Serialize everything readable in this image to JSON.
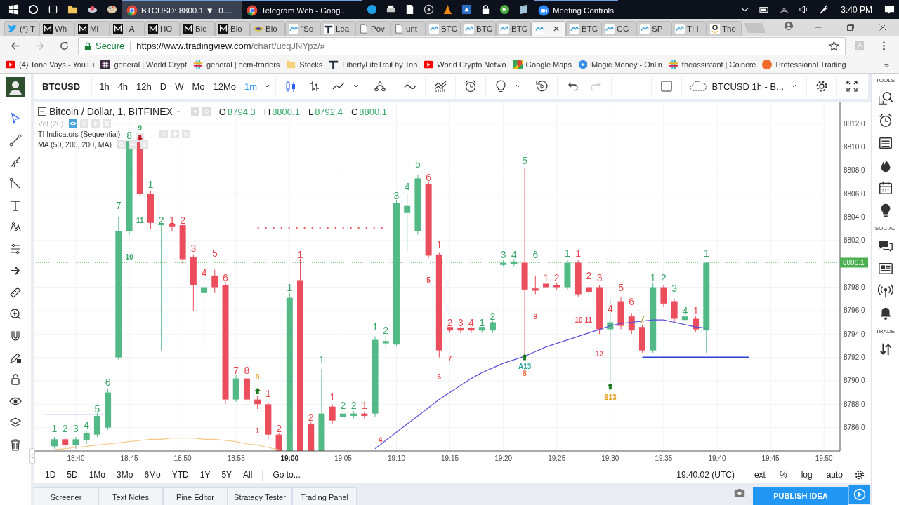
{
  "taskbar": {
    "apps": [
      {
        "title": "BTCUSD: 8800.1 ▼−0....",
        "kind": "browser",
        "selected": true
      },
      {
        "title": "Telegram Web - Goog...",
        "kind": "browser",
        "selected": false
      },
      {
        "title": "Meeting Controls",
        "kind": "meeting",
        "selected": false
      }
    ],
    "clock": "3:40 PM"
  },
  "browser": {
    "tabs": [
      {
        "label": "(*) T",
        "kind": "bird",
        "selected": false
      },
      {
        "label": "Wh",
        "kind": "m",
        "selected": false
      },
      {
        "label": "Mi",
        "kind": "m",
        "selected": false
      },
      {
        "label": "I A",
        "kind": "m",
        "selected": false
      },
      {
        "label": "HO",
        "kind": "m",
        "selected": false
      },
      {
        "label": "Blo",
        "kind": "m",
        "selected": false
      },
      {
        "label": "Blo",
        "kind": "m",
        "selected": false
      },
      {
        "label": "Blo",
        "kind": "wj",
        "selected": false
      },
      {
        "label": "\"Sc",
        "kind": "tv",
        "selected": false
      },
      {
        "label": "Lea",
        "kind": "t",
        "selected": false
      },
      {
        "label": "Pov",
        "kind": "doc",
        "selected": false
      },
      {
        "label": "unt",
        "kind": "doc",
        "selected": false
      },
      {
        "label": "BTC",
        "kind": "tv",
        "selected": false
      },
      {
        "label": "BTC",
        "kind": "tv",
        "selected": false
      },
      {
        "label": "BTC",
        "kind": "tv",
        "selected": false
      },
      {
        "kind": "tv",
        "selected": true
      },
      {
        "label": "BTC",
        "kind": "tv",
        "selected": false
      },
      {
        "label": "GC",
        "kind": "tv",
        "selected": false
      },
      {
        "label": "SP",
        "kind": "tv",
        "selected": false
      },
      {
        "label": "TI I",
        "kind": "tv",
        "selected": false
      },
      {
        "label": "The",
        "kind": "a",
        "selected": false
      }
    ],
    "secure": "Secure",
    "url_host": "https://www.tradingview.com",
    "url_path": "/chart/ucqJNYpz/#",
    "bookmarks": [
      {
        "label": "(4) Tone Vays - YouTu",
        "kind": "play"
      },
      {
        "label": "general | World Crypt",
        "kind": "hash"
      },
      {
        "label": "general | ecm-traders",
        "kind": "slack"
      },
      {
        "label": "Stocks",
        "kind": "folder"
      },
      {
        "label": "LibertyLifeTrail by Ton",
        "kind": "t"
      },
      {
        "label": "World Crypto Netwo",
        "kind": "play"
      },
      {
        "label": "Google Maps",
        "kind": "pin"
      },
      {
        "label": "Magic Money - Onlin",
        "kind": "hex"
      },
      {
        "label": "theassistant | Coincre",
        "kind": "slack"
      },
      {
        "label": "Professional Trading",
        "kind": "circle"
      }
    ],
    "more": "»"
  },
  "chart_toolbar": {
    "symbol": "BTCUSD",
    "intervals": [
      {
        "label": "1h",
        "selected": false
      },
      {
        "label": "4h",
        "selected": false
      },
      {
        "label": "12h",
        "selected": false
      },
      {
        "label": "D",
        "selected": false
      },
      {
        "label": "W",
        "selected": false
      },
      {
        "label": "Mo",
        "selected": false
      },
      {
        "label": "12Mo",
        "selected": false
      },
      {
        "label": "1m",
        "selected": true
      }
    ],
    "layout": "BTCUSD 1h - B..."
  },
  "legend": {
    "title": "Bitcoin / Dollar, 1, BITFINEX",
    "ohlc": [
      {
        "key": "O",
        "value": "8794.3"
      },
      {
        "key": "H",
        "value": "8800.1"
      },
      {
        "key": "L",
        "value": "8792.4"
      },
      {
        "key": "C",
        "value": "8800.1"
      }
    ],
    "indicators": [
      {
        "name": "Vol (20)",
        "hidden": true
      },
      {
        "name": "TI Indicators (Sequential)",
        "hidden": false
      },
      {
        "name": "MA (50, 200, 200, MA)",
        "hidden": false
      }
    ]
  },
  "chart": {
    "price_labels": [
      "8812.0",
      "8810.0",
      "8808.0",
      "8806.0",
      "8804.0",
      "8802.0",
      "8798.0",
      "8796.0",
      "8794.0",
      "8792.0",
      "8790.0",
      "8788.0",
      "8786.0"
    ],
    "last_price": "8800.1",
    "time_labels": [
      {
        "label": "18:40",
        "bold": false
      },
      {
        "label": "18:45",
        "bold": false
      },
      {
        "label": "18:50",
        "bold": false
      },
      {
        "label": "18:55",
        "bold": false
      },
      {
        "label": "19:00",
        "bold": true
      },
      {
        "label": "19:05",
        "bold": false
      },
      {
        "label": "19:10",
        "bold": false
      },
      {
        "label": "19:15",
        "bold": false
      },
      {
        "label": "19:20",
        "bold": false
      },
      {
        "label": "19:25",
        "bold": false
      },
      {
        "label": "19:30",
        "bold": false
      },
      {
        "label": "19:35",
        "bold": false
      },
      {
        "label": "19:40",
        "bold": false
      },
      {
        "label": "19:45",
        "bold": false
      },
      {
        "label": "19:50",
        "bold": false
      }
    ],
    "counts": [
      {
        "text": "1",
        "color": "#3aa86b"
      },
      {
        "text": "2",
        "color": "#3aa86b"
      },
      {
        "text": "3",
        "color": "#3aa86b"
      },
      {
        "text": "4",
        "color": "#3aa86b"
      },
      {
        "text": "5",
        "color": "#3aa86b"
      },
      {
        "text": "6",
        "color": "#3aa86b"
      },
      {
        "text": "7",
        "color": "#3aa86b"
      },
      {
        "text": "8",
        "color": "#3aa86b"
      },
      {
        "text": "9",
        "color": "#3aa86b"
      },
      {
        "text": "1",
        "color": "#3aa86b"
      },
      {
        "text": "2",
        "color": "#3aa86b"
      },
      {
        "text": "1",
        "color": "#e8474f"
      },
      {
        "text": "2",
        "color": "#e8474f"
      },
      {
        "text": "3",
        "color": "#e8474f"
      },
      {
        "text": "4",
        "color": "#e8474f"
      },
      {
        "text": "5",
        "color": "#e8474f"
      },
      {
        "text": "6",
        "color": "#e8474f"
      },
      {
        "text": "7",
        "color": "#e8474f"
      },
      {
        "text": "8",
        "color": "#e8474f"
      },
      {
        "text": "9",
        "color": "#e39a12"
      },
      {
        "text": "1",
        "color": "#e8474f"
      },
      {
        "text": "2",
        "color": "#e8474f"
      },
      {
        "text": "1",
        "color": "#3aa86b"
      },
      {
        "text": "1",
        "color": "#e8474f"
      },
      {
        "text": "2",
        "color": "#e8474f"
      },
      {
        "text": "1",
        "color": "#3aa86b"
      },
      {
        "text": "1",
        "color": "#e8474f"
      },
      {
        "text": "2",
        "color": "#3aa86b"
      },
      {
        "text": "2",
        "color": "#3aa86b"
      },
      {
        "text": "1",
        "color": "#e8474f"
      },
      {
        "text": "1",
        "color": "#3aa86b"
      },
      {
        "text": "2",
        "color": "#3aa86b"
      },
      {
        "text": "3",
        "color": "#3aa86b"
      },
      {
        "text": "4",
        "color": "#3aa86b"
      },
      {
        "text": "5",
        "color": "#3aa86b"
      },
      {
        "text": "6",
        "color": "#e8474f"
      },
      {
        "text": "1",
        "color": "#e8474f"
      },
      {
        "text": "2",
        "color": "#e8474f"
      },
      {
        "text": "3",
        "color": "#e8474f"
      },
      {
        "text": "4",
        "color": "#e8474f"
      },
      {
        "text": "1",
        "color": "#3aa86b"
      },
      {
        "text": "2",
        "color": "#3aa86b"
      },
      {
        "text": "3",
        "color": "#3aa86b"
      },
      {
        "text": "4",
        "color": "#3aa86b"
      },
      {
        "text": "5",
        "color": "#3aa86b"
      },
      {
        "text": "6",
        "color": "#3aa86b"
      },
      {
        "text": "1",
        "color": "#e8474f"
      },
      {
        "text": "2",
        "color": "#e8474f"
      },
      {
        "text": "1",
        "color": "#3aa86b"
      },
      {
        "text": "1",
        "color": "#e8474f"
      },
      {
        "text": "2",
        "color": "#e8474f"
      },
      {
        "text": "3",
        "color": "#e8474f"
      },
      {
        "text": "4",
        "color": "#e8474f"
      },
      {
        "text": "5",
        "color": "#e8474f"
      },
      {
        "text": "6",
        "color": "#e8474f"
      },
      {
        "text": "7",
        "color": "#b3a33c"
      },
      {
        "text": "1",
        "color": "#3aa86b"
      },
      {
        "text": "2",
        "color": "#3aa86b"
      },
      {
        "text": "3",
        "color": "#3aa86b"
      },
      {
        "text": "4",
        "color": "#3aa86b"
      },
      {
        "text": "1",
        "color": "#e8474f"
      },
      {
        "text": "1",
        "color": "#3aa86b"
      },
      {
        "text": "10",
        "color": "#3aa86b"
      },
      {
        "text": "11",
        "color": "#3aa86b"
      },
      {
        "text": "1",
        "color": "#e8474f"
      },
      {
        "text": "4",
        "color": "#e8474f"
      },
      {
        "text": "5",
        "color": "#e8474f"
      },
      {
        "text": "7",
        "color": "#e8474f"
      },
      {
        "text": "6",
        "color": "#e8474f"
      },
      {
        "text": "9",
        "color": "#e8474f"
      },
      {
        "text": "10 11",
        "color": "#e8474f"
      },
      {
        "text": "12",
        "color": "#e8474f"
      },
      {
        "text": "A13",
        "color": "#26a69a"
      },
      {
        "text": "8",
        "color": "#e8774f"
      },
      {
        "text": "S13",
        "color": "#e39a12"
      }
    ]
  },
  "bottom_bar": {
    "ranges": [
      "1D",
      "5D",
      "1Mo",
      "3Mo",
      "6Mo",
      "YTD",
      "1Y",
      "5Y",
      "All"
    ],
    "goto": "Go to...",
    "clock": "19:40:02 (UTC)",
    "options": [
      "ext",
      "%",
      "log",
      "auto"
    ]
  },
  "panel_tabs": [
    "Screener",
    "Text Notes",
    "Pine Editor",
    "Strategy Tester",
    "Trading Panel"
  ],
  "publish": "PUBLISH IDEA",
  "right_sidebar": {
    "sections": [
      {
        "label": "TOOLS"
      },
      {
        "label": "SOCIAL"
      },
      {
        "label": "TRADE"
      }
    ]
  }
}
